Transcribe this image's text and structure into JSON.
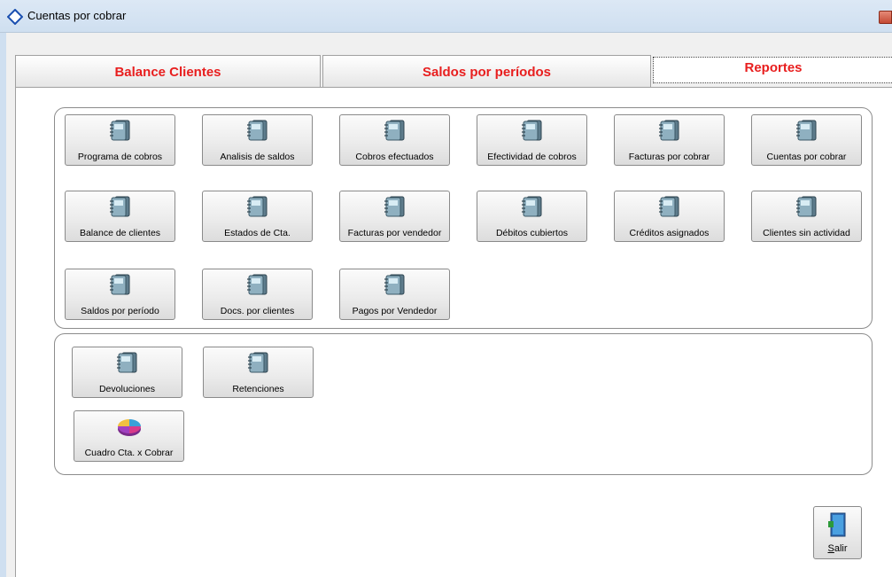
{
  "window": {
    "title": "Cuentas por cobrar"
  },
  "tabs": [
    {
      "label": "Balance Clientes"
    },
    {
      "label": "Saldos por períodos"
    },
    {
      "label": "Reportes",
      "selected": true
    }
  ],
  "group1": {
    "row1": [
      "Programa de cobros",
      "Analisis de saldos",
      "Cobros efectuados",
      "Efectividad de cobros",
      "Facturas por cobrar",
      "Cuentas por cobrar"
    ],
    "row2": [
      "Balance de clientes",
      "Estados de Cta.",
      "Facturas por vendedor",
      "Débitos cubiertos",
      "Créditos asignados",
      "Clientes sin actividad"
    ],
    "row3": [
      "Saldos por período",
      "Docs. por clientes",
      "Pagos por Vendedor"
    ]
  },
  "group2": {
    "row1": [
      "Devoluciones",
      "Retenciones"
    ],
    "row2": [
      "Cuadro Cta. x Cobrar"
    ]
  },
  "exit": {
    "label": "Salir"
  },
  "colors": {
    "tab_text": "#e81e1e",
    "titlebar": "#cfdff0"
  },
  "icons": {
    "report": "binder-report-icon",
    "chart": "pie-chart-icon",
    "exit": "door-exit-icon"
  }
}
